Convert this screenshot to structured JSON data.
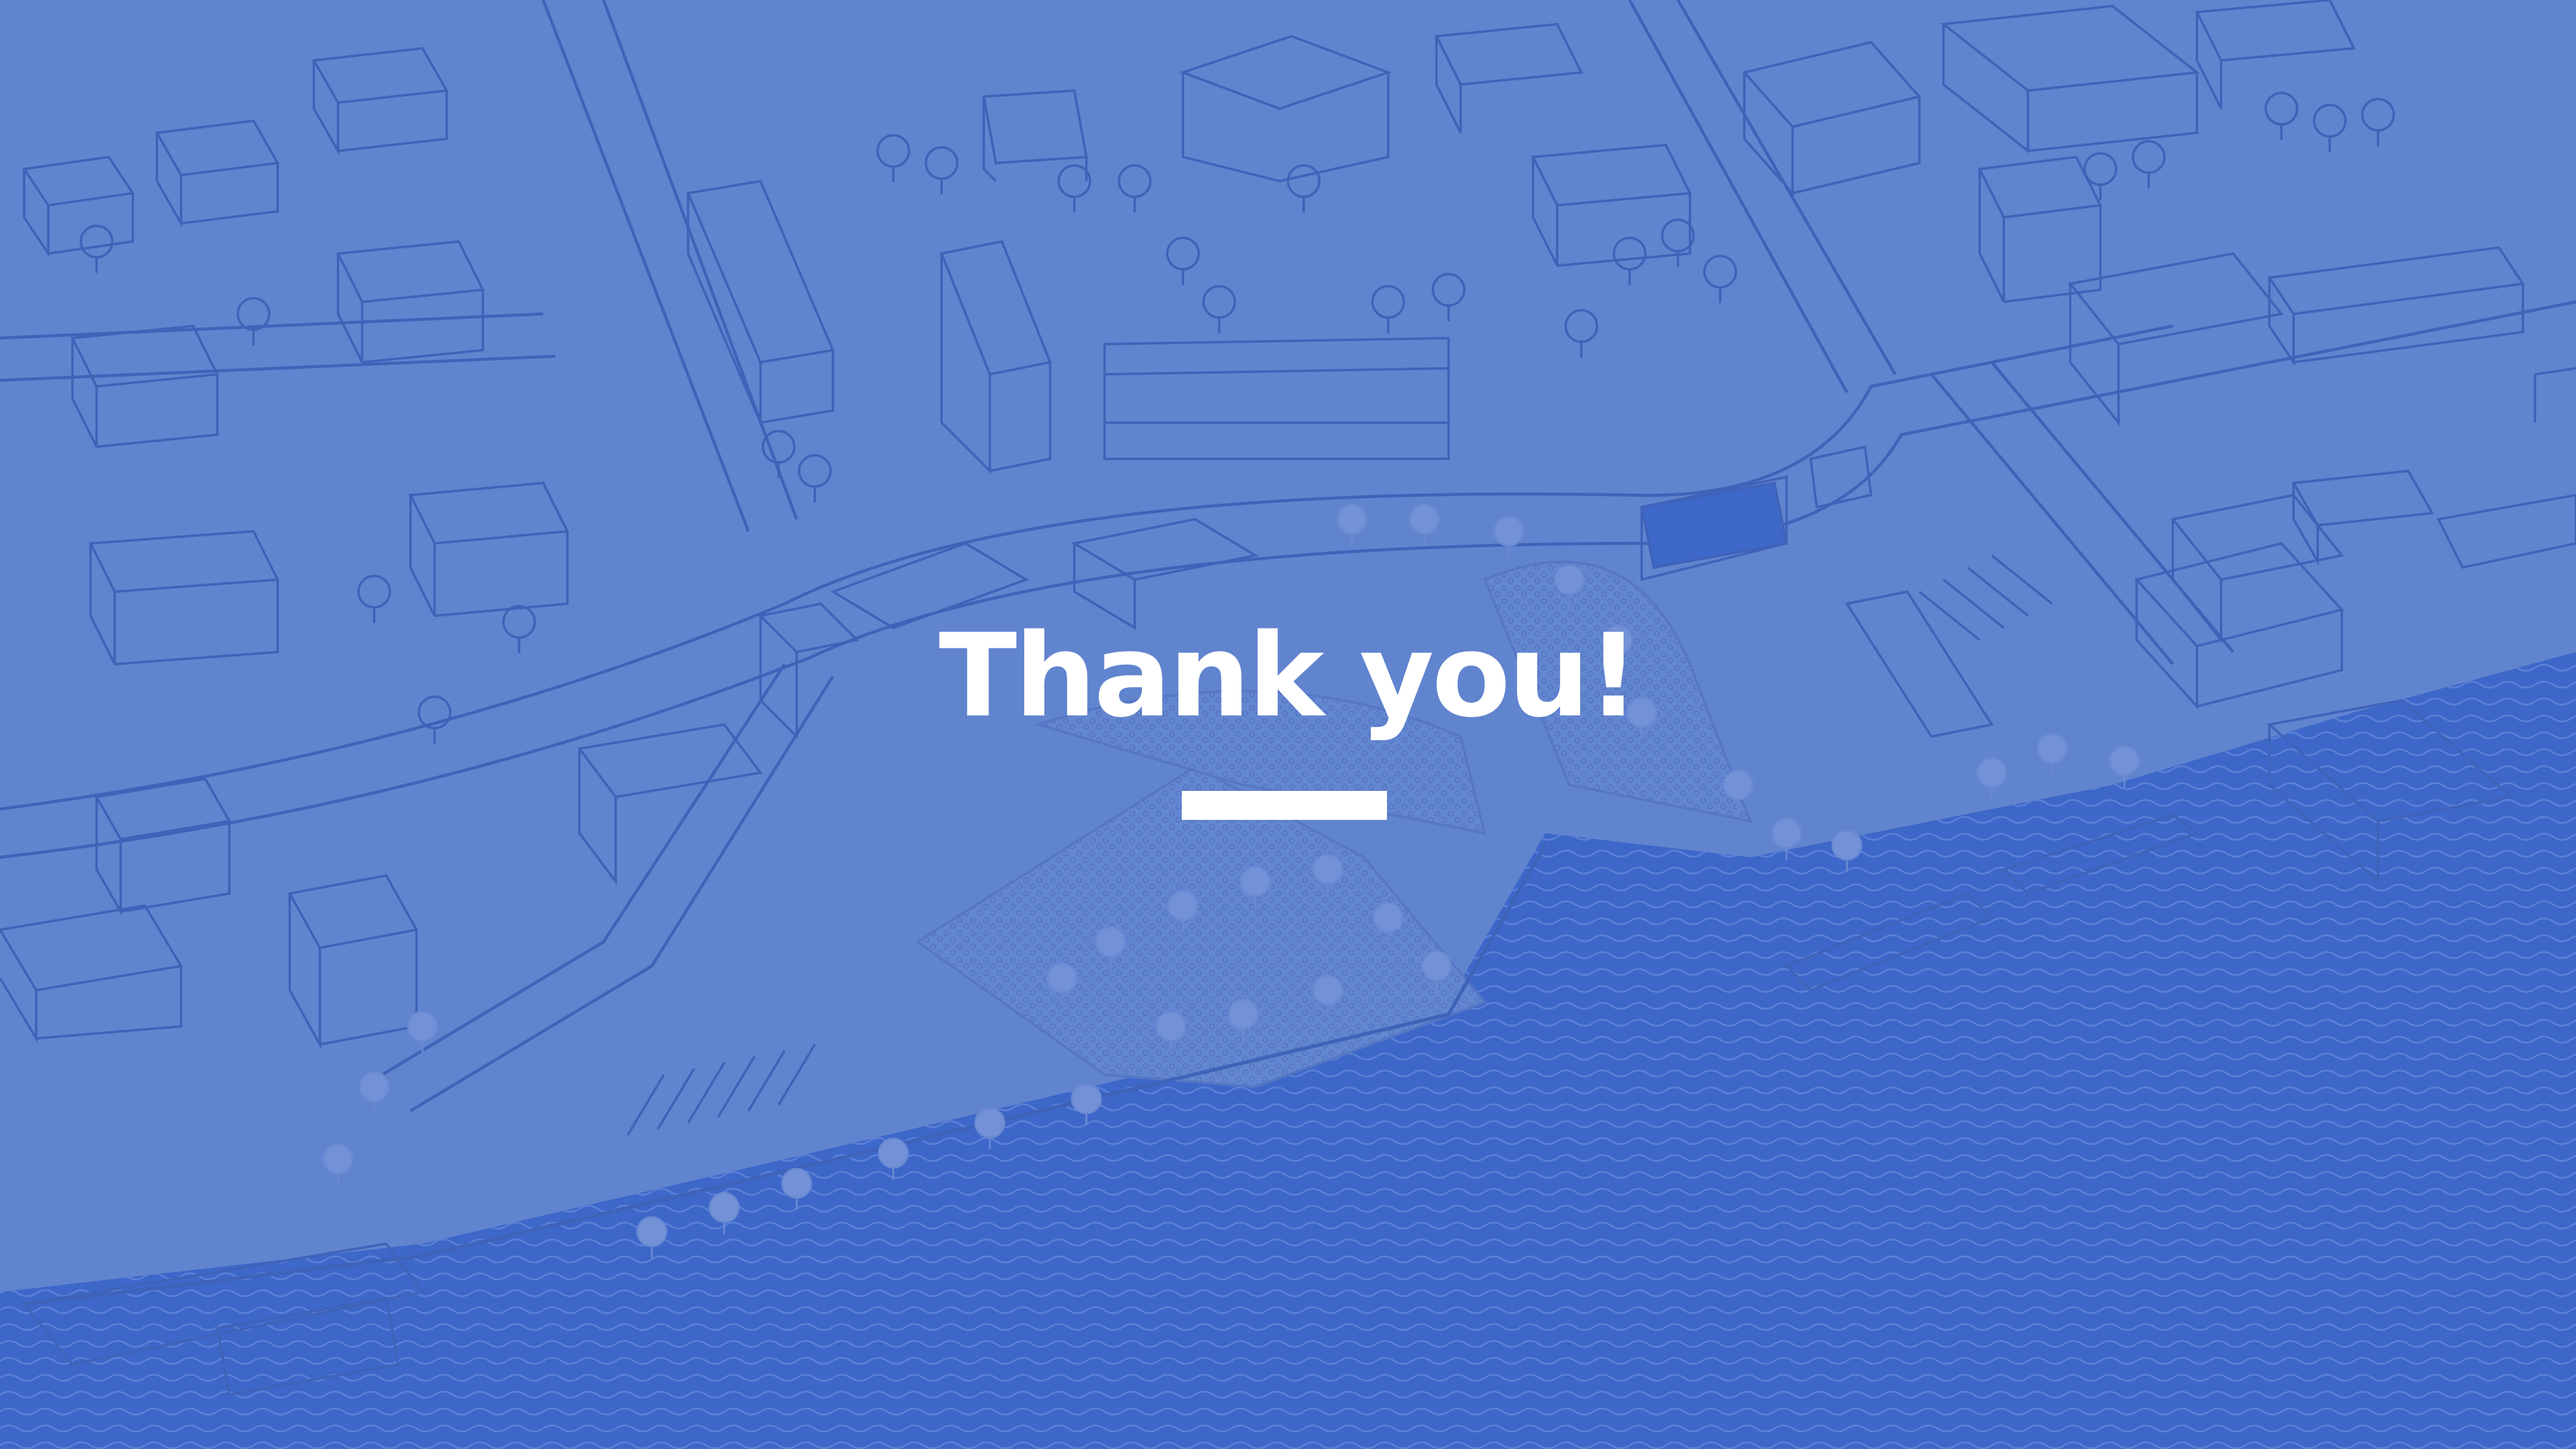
{
  "slide": {
    "title": "Thank you!",
    "background_theme": "blueprint-city-waterfront-map",
    "colors": {
      "overlay_blue": "#6184cf",
      "line_blue": "#3f63b8",
      "water_blue": "#3d67c9",
      "text": "#ffffff"
    }
  }
}
